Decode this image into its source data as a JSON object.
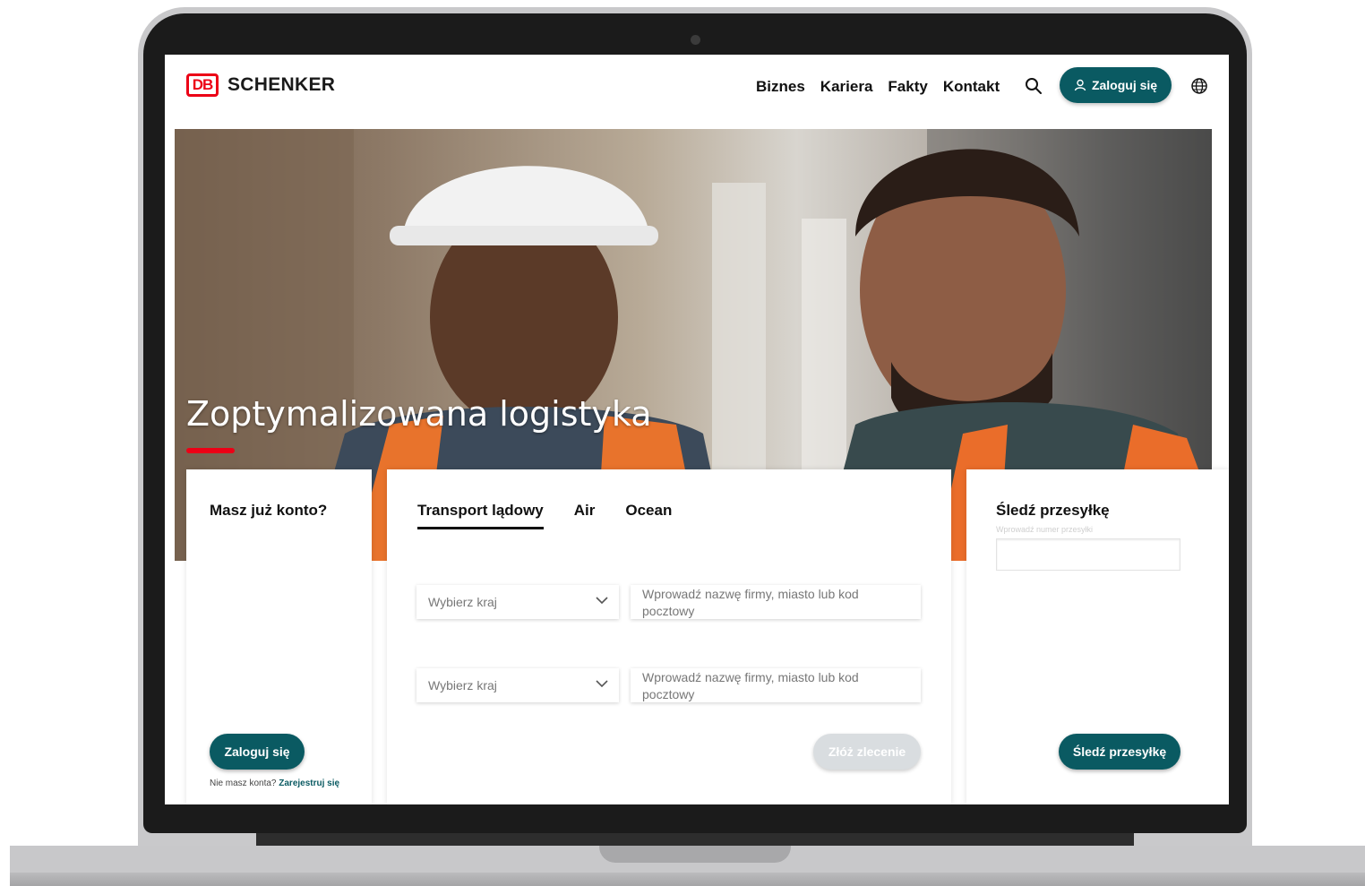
{
  "header": {
    "logo_mark": "DB",
    "logo_text": "SCHENKER",
    "nav": [
      "Biznes",
      "Kariera",
      "Fakty",
      "Kontakt"
    ],
    "login_label": "Zaloguj się"
  },
  "hero": {
    "title": "Zoptymalizowana logistyka"
  },
  "account_card": {
    "heading": "Masz już konto?",
    "login_label": "Zaloguj się",
    "no_account_text": "Nie masz konta?",
    "register_link": "Zarejestruj się"
  },
  "transport_card": {
    "tabs": [
      "Transport lądowy",
      "Air",
      "Ocean"
    ],
    "active_tab": "Transport lądowy",
    "rows": [
      {
        "country_placeholder": "Wybierz kraj",
        "address_placeholder": "Wprowadź nazwę firmy, miasto lub kod pocztowy"
      },
      {
        "country_placeholder": "Wybierz kraj",
        "address_placeholder": "Wprowadź nazwę firmy, miasto lub kod pocztowy"
      }
    ],
    "submit_label": "Złóż zlecenie"
  },
  "track_card": {
    "heading": "Śledź przesyłkę",
    "input_hint": "Wprowadź numer przesyłki",
    "button_label": "Śledź przesyłkę"
  },
  "colors": {
    "brand_red": "#ec0016",
    "teal": "#0a5a62",
    "disabled": "#d9dde0"
  }
}
